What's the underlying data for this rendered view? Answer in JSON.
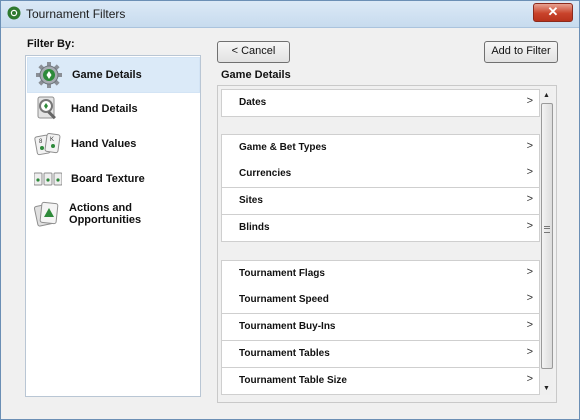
{
  "window": {
    "title": "Tournament Filters",
    "close_label": "✕"
  },
  "left": {
    "heading": "Filter By:",
    "items": [
      {
        "label": "Game Details",
        "icon": "gear-icon",
        "selected": true
      },
      {
        "label": "Hand Details",
        "icon": "magnifier-card-icon"
      },
      {
        "label": "Hand Values",
        "icon": "playing-cards-icon"
      },
      {
        "label": "Board Texture",
        "icon": "board-cards-icon"
      },
      {
        "label": "Actions and Opportunities",
        "icon": "action-cards-icon"
      }
    ]
  },
  "toolbar": {
    "cancel_label": "< Cancel",
    "add_label": "Add to Filter"
  },
  "main": {
    "section_title": "Game Details",
    "groups": [
      [
        "Dates"
      ],
      [
        "Game & Bet Types",
        "Currencies",
        "Sites",
        "Blinds"
      ],
      [
        "Tournament Flags",
        "Tournament Speed",
        "Tournament Buy-Ins",
        "Tournament Tables",
        "Tournament Table Size"
      ]
    ],
    "chevron": ">"
  },
  "scroll": {
    "up": "▲",
    "down": "▼"
  },
  "colors": {
    "accent": "#3a8a3a",
    "selected_bg": "#dbeaf8",
    "close_red": "#c9432b"
  }
}
